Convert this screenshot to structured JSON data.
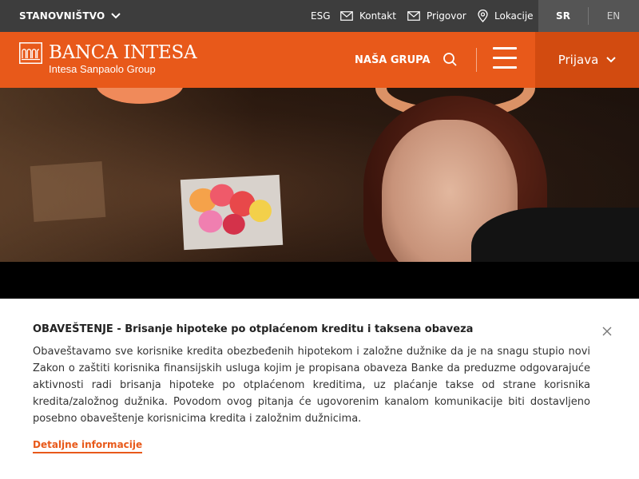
{
  "topbar": {
    "segment_label": "STANOVNIŠTVO",
    "links": {
      "esg": "ESG",
      "kontakt": "Kontakt",
      "prigovor": "Prigovor",
      "lokacije": "Lokacije"
    },
    "languages": {
      "active": "SR",
      "other": "EN"
    }
  },
  "header": {
    "logo_main": "BANCA INTESA",
    "logo_sub": "Intesa Sanpaolo Group",
    "nav_group": "NAŠA GRUPA",
    "login_label": "Prijava"
  },
  "notice": {
    "title": "OBAVEŠTENJE - Brisanje hipoteke po otplaćenom kreditu i taksena obaveza",
    "body": "Obaveštavamo sve korisnike kredita obezbeđenih hipotekom i založne dužnike da je na snagu stupio novi Zakon o zaštiti korisnika finansijskih usluga kojim je propisana obaveza Banke da preduzme odgovarajuće aktivnosti radi brisanja hipoteke po otplaćenom kreditima, uz plaćanje takse od strane korisnika kredita/založnog dužnika. Povodom ovog pitanja će ugovorenim kanalom komunikacije biti dostavljeno posebno obaveštenje korisnicima kredita i založnim dužnicima.",
    "link": "Detaljne informacije"
  },
  "colors": {
    "brand_orange": "#e8591a",
    "login_orange": "#d24b10",
    "topbar_gray": "#3d3d3d",
    "lang_gray": "#555555"
  },
  "icons": [
    "chevron-down-icon",
    "leaf-icon",
    "envelope-icon",
    "pin-icon",
    "search-icon",
    "hamburger-menu-icon",
    "close-icon",
    "logo-arches-icon"
  ]
}
